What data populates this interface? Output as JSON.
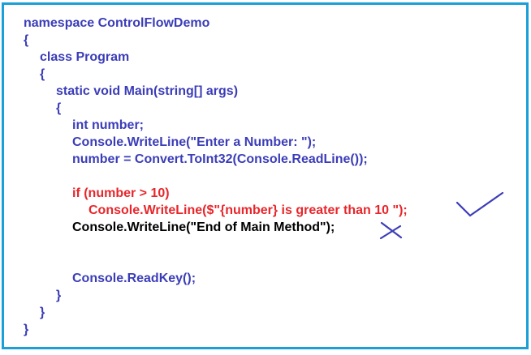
{
  "code_lines": [
    {
      "indent": 0,
      "text": "namespace ControlFlowDemo",
      "color": "blue"
    },
    {
      "indent": 0,
      "text": "{",
      "color": "blue"
    },
    {
      "indent": 1,
      "text": "class Program",
      "color": "blue"
    },
    {
      "indent": 1,
      "text": "{",
      "color": "blue"
    },
    {
      "indent": 2,
      "text": "static void Main(string[] args)",
      "color": "blue"
    },
    {
      "indent": 2,
      "text": "{",
      "color": "blue"
    },
    {
      "indent": 3,
      "text": "int number;",
      "color": "blue"
    },
    {
      "indent": 3,
      "text": "Console.WriteLine(\"Enter a Number: \");",
      "color": "blue"
    },
    {
      "indent": 3,
      "text": "number = Convert.ToInt32(Console.ReadLine());",
      "color": "blue"
    },
    {
      "indent": 3,
      "text": "",
      "color": "blue"
    },
    {
      "indent": 3,
      "text": "if (number > 10)",
      "color": "red"
    },
    {
      "indent": 4,
      "text": "Console.WriteLine($\"{number} is greater than 10 \");",
      "color": "red"
    },
    {
      "indent": 3,
      "text": "Console.WriteLine(\"End of Main Method\");",
      "color": "black"
    },
    {
      "indent": 3,
      "text": "",
      "color": "blue"
    },
    {
      "indent": 3,
      "text": "",
      "color": "blue"
    },
    {
      "indent": 3,
      "text": "Console.ReadKey();",
      "color": "blue"
    },
    {
      "indent": 2,
      "text": "}",
      "color": "blue"
    },
    {
      "indent": 1,
      "text": "}",
      "color": "blue"
    },
    {
      "indent": 0,
      "text": "}",
      "color": "blue"
    }
  ],
  "annotations": {
    "check_mark_icon": "checkmark",
    "cross_mark_icon": "cross"
  },
  "colors": {
    "border": "#1a9fd8",
    "blue": "#3b3db8",
    "red": "#e8262b",
    "black": "#000000"
  }
}
